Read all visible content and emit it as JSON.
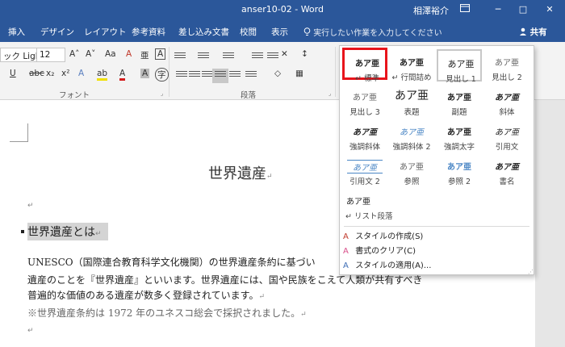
{
  "titlebar": {
    "doc_title": "anser10-02  -  Word",
    "user_name": "相澤裕介",
    "ribbon_display_icon": "ribbon-display-icon",
    "minimize_label": "─",
    "maximize_label": "□",
    "close_label": "✕"
  },
  "tabs": [
    "挿入",
    "デザイン",
    "レイアウト",
    "参考資料",
    "差し込み文書",
    "校閲",
    "表示"
  ],
  "tell_me": {
    "icon": "lightbulb-icon",
    "label": "実行したい作業を入力してください"
  },
  "share": {
    "icon": "person-icon",
    "label": "共有"
  },
  "ribbon": {
    "font_name": "ック Ligh",
    "font_size": "12",
    "grow_font": "A˄",
    "shrink_font": "A˅",
    "change_case": "Aa",
    "clear_format": "A",
    "phonetic_guide": "亜",
    "enclose": "A",
    "underline": "U",
    "strike": "abc",
    "subscript": "x₂",
    "superscript": "x²",
    "text_effects": "A",
    "highlight": "ab",
    "font_color": "A",
    "char_shading": "A",
    "enclosed_char": "字",
    "font_group": "フォント",
    "para_group": "段落",
    "accent_colors": {
      "highlight": "#f0e000",
      "font_color": "#d31b1b",
      "title_bar": "#2b579a",
      "selected_border": "#e8141b"
    }
  },
  "gallery": {
    "styles": [
      {
        "preview": "あア亜",
        "label": "↵ 標準",
        "selected": true
      },
      {
        "preview": "あア亜",
        "label": "↵ 行間詰め"
      },
      {
        "preview": "あア亜",
        "label": "見出し 1",
        "hover": true
      },
      {
        "preview": "あア亜",
        "label": "見出し 2"
      },
      {
        "preview": "あア亜",
        "label": "見出し 3"
      },
      {
        "preview": "あア亜",
        "label": "表題"
      },
      {
        "preview": "あア亜",
        "label": "副題"
      },
      {
        "preview": "あア亜",
        "label": "斜体"
      },
      {
        "preview": "あア亜",
        "label": "強調斜体"
      },
      {
        "preview": "あア亜",
        "label": "強調斜体 2"
      },
      {
        "preview": "あア亜",
        "label": "強調太字"
      },
      {
        "preview": "あア亜",
        "label": "引用文"
      },
      {
        "preview": "あア亜",
        "label": "引用文 2"
      },
      {
        "preview": "あア亜",
        "label": "参照"
      },
      {
        "preview": "あア亜",
        "label": "参照 2"
      },
      {
        "preview": "あア亜",
        "label": "書名"
      },
      {
        "preview": "あア亜",
        "label": "↵ リスト段落"
      }
    ],
    "commands": [
      {
        "icon": "new-style-icon",
        "label": "スタイルの作成(S)"
      },
      {
        "icon": "clear-formatting-icon",
        "label": "書式のクリア(C)"
      },
      {
        "icon": "apply-styles-icon",
        "label": "スタイルの適用(A)..."
      }
    ]
  },
  "document": {
    "title": "世界遺産",
    "paragraph_mark": "↵",
    "heading": "世界遺産とは",
    "body_lines": [
      "UNESCO（国際連合教育科学文化機関）の世界遺産条約に基づい",
      "遺産のことを『世界遺産』といいます。世界遺産には、国や民族をこえて人類が共有すべき",
      "普遍的な価値のある遺産が数多く登録されています。"
    ],
    "note": "※世界遺産条約は 1972 年のユネスコ総会で採択されました。"
  }
}
